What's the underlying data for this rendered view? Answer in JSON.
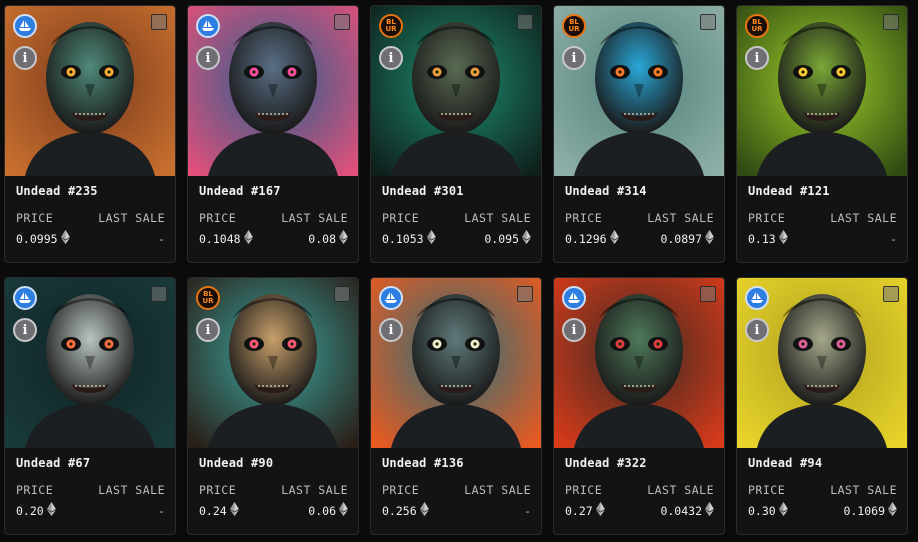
{
  "cards": [
    {
      "name": "Undead #235",
      "price_label": "PRICE",
      "last_sale_label": "LAST SALE",
      "price": "0.0995",
      "last_sale": "-",
      "marketplace": "opensea",
      "marketplace_label": "",
      "colors": {
        "bg": "#c9702f",
        "bg2": "#7a3a1c",
        "skin": "#4f8a7a",
        "eye": "#ffb13a"
      }
    },
    {
      "name": "Undead #167",
      "price_label": "PRICE",
      "last_sale_label": "LAST SALE",
      "price": "0.1048",
      "last_sale": "0.08",
      "marketplace": "opensea",
      "marketplace_label": "",
      "colors": {
        "bg": "#e0507a",
        "bg2": "#2a5f8f",
        "skin": "#5a6f86",
        "eye": "#ff4fa0"
      }
    },
    {
      "name": "Undead #301",
      "price_label": "PRICE",
      "last_sale_label": "LAST SALE",
      "price": "0.1053",
      "last_sale": "0.095",
      "marketplace": "blur",
      "marketplace_label": "BL UR",
      "colors": {
        "bg": "#0f1f1c",
        "bg2": "#1c8f6f",
        "skin": "#5a6b52",
        "eye": "#f0a040"
      }
    },
    {
      "name": "Undead #314",
      "price_label": "PRICE",
      "last_sale_label": "LAST SALE",
      "price": "0.1296",
      "last_sale": "0.0897",
      "marketplace": "blur",
      "marketplace_label": "BL UR",
      "colors": {
        "bg": "#8fb0a8",
        "bg2": "#4f7f78",
        "skin": "#2aa8d8",
        "eye": "#ff7a2a"
      }
    },
    {
      "name": "Undead #121",
      "price_label": "PRICE",
      "last_sale_label": "LAST SALE",
      "price": "0.13",
      "last_sale": "-",
      "marketplace": "blur",
      "marketplace_label": "BL UR",
      "colors": {
        "bg": "#2f4a12",
        "bg2": "#9fcf2a",
        "skin": "#7aa836",
        "eye": "#ffcc33"
      }
    },
    {
      "name": "Undead #67",
      "price_label": "PRICE",
      "last_sale_label": "LAST SALE",
      "price": "0.20",
      "last_sale": "-",
      "marketplace": "opensea",
      "marketplace_label": "",
      "colors": {
        "bg": "#1a3a3a",
        "bg2": "#0f2426",
        "skin": "#b8c4c0",
        "eye": "#ff7040"
      }
    },
    {
      "name": "Undead #90",
      "price_label": "PRICE",
      "last_sale_label": "LAST SALE",
      "price": "0.24",
      "last_sale": "0.06",
      "marketplace": "blur",
      "marketplace_label": "BL UR",
      "colors": {
        "bg": "#2a1e18",
        "bg2": "#3aa8a0",
        "skin": "#c8a06a",
        "eye": "#ff5a7a"
      }
    },
    {
      "name": "Undead #136",
      "price_label": "PRICE",
      "last_sale_label": "LAST SALE",
      "price": "0.256",
      "last_sale": "-",
      "marketplace": "opensea",
      "marketplace_label": "",
      "colors": {
        "bg": "#e85a20",
        "bg2": "#2a6f7a",
        "skin": "#5f7a7a",
        "eye": "#f0f0d0"
      }
    },
    {
      "name": "Undead #322",
      "price_label": "PRICE",
      "last_sale_label": "LAST SALE",
      "price": "0.27",
      "last_sale": "0.0432",
      "marketplace": "opensea",
      "marketplace_label": "",
      "colors": {
        "bg": "#d83a1a",
        "bg2": "#3a2a22",
        "skin": "#4f7a5a",
        "eye": "#e04040"
      }
    },
    {
      "name": "Undead #94",
      "price_label": "PRICE",
      "last_sale_label": "LAST SALE",
      "price": "0.30",
      "last_sale": "0.1069",
      "marketplace": "opensea",
      "marketplace_label": "",
      "colors": {
        "bg": "#e8d42a",
        "bg2": "#b0a020",
        "skin": "#a6a88a",
        "eye": "#e060a0"
      }
    }
  ]
}
